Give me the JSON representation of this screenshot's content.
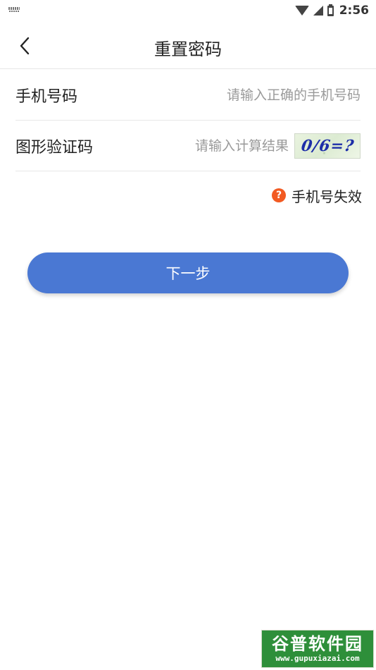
{
  "status_bar": {
    "time": "2:56",
    "icons": [
      "keyboard-icon",
      "wifi-icon",
      "signal-icon",
      "battery-icon"
    ]
  },
  "nav": {
    "title": "重置密码",
    "back_icon": "chevron-left-icon"
  },
  "form": {
    "phone": {
      "label": "手机号码",
      "placeholder": "请输入正确的手机号码",
      "value": ""
    },
    "captcha": {
      "label": "图形验证码",
      "placeholder": "请输入计算结果",
      "value": "",
      "image_text": "0/6=?"
    }
  },
  "error": {
    "icon": "question-circle-icon",
    "text": "手机号失效",
    "color": "#f25a22"
  },
  "next_button": {
    "label": "下一步",
    "color": "#4a78d3"
  },
  "watermark": {
    "title": "谷普软件园",
    "url": "www.gupuxiazai.com"
  }
}
